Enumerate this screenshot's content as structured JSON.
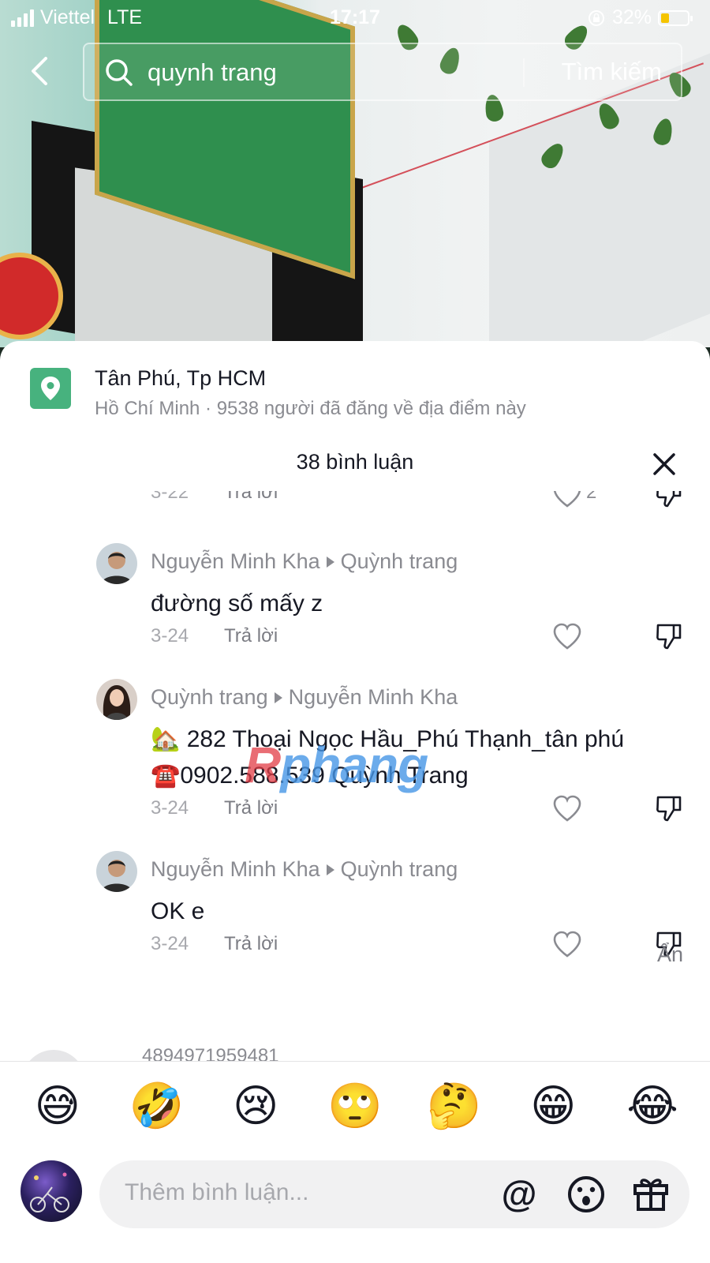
{
  "status_bar": {
    "carrier": "Viettel",
    "network": "LTE",
    "time": "17:17",
    "battery": "32%",
    "battery_level": 0.32
  },
  "search": {
    "query": "quynh trang",
    "submit_label": "Tìm kiếm"
  },
  "location": {
    "name": "Tân Phú, Tp HCM",
    "subtitle": "Hồ Chí Minh · 9538 người đã đăng về địa điểm này",
    "icon": "map-pin-icon",
    "icon_color": "#47b27e"
  },
  "comments_header": "38 bình luận",
  "partial_comment": {
    "date": "3-22",
    "reply_label": "Trả lời",
    "likes": "2"
  },
  "comments": [
    {
      "author": "Nguyễn Minh Kha",
      "reply_to": "Quỳnh trang",
      "text": "đường số mấy z",
      "date": "3-24",
      "reply_label": "Trả lời"
    },
    {
      "author": "Quỳnh trang",
      "reply_to": "Nguyễn Minh Kha",
      "text_line1": "🏡 282 Thoại Ngọc Hầu_Phú Thạnh_tân phú",
      "text_line2": "☎️0902.588.539 Quỳnh Trang",
      "date": "3-24",
      "reply_label": "Trả lời"
    },
    {
      "author": "Nguyễn Minh Kha",
      "reply_to": "Quỳnh trang",
      "text": "OK e",
      "date": "3-24",
      "reply_label": "Trả lời"
    }
  ],
  "hide_label": "Ẩn",
  "next_comment_peek": "4894971959481",
  "watermark": {
    "part1": "R",
    "part2": "phang"
  },
  "emoji_bar": [
    "😅",
    "🤣",
    "😢",
    "🙄",
    "🤔",
    "😁",
    "😂"
  ],
  "input": {
    "placeholder": "Thêm bình luận...",
    "mention_label": "@"
  }
}
